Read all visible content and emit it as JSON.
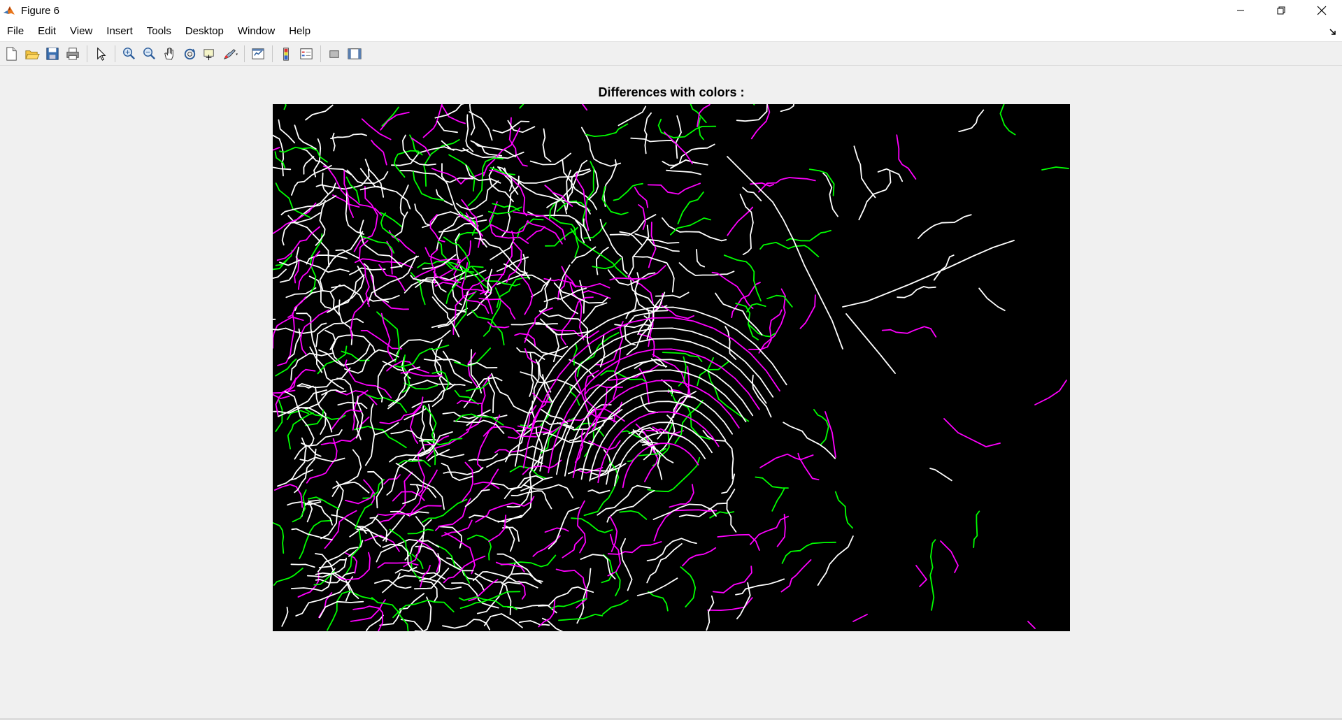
{
  "window": {
    "title": "Figure 6"
  },
  "menu": [
    "File",
    "Edit",
    "View",
    "Insert",
    "Tools",
    "Desktop",
    "Window",
    "Help"
  ],
  "toolbar": [
    {
      "name": "new-figure-icon"
    },
    {
      "name": "open-file-icon"
    },
    {
      "name": "save-icon"
    },
    {
      "name": "print-icon"
    },
    {
      "sep": true
    },
    {
      "name": "edit-plot-arrow-icon"
    },
    {
      "sep": true
    },
    {
      "name": "zoom-in-icon"
    },
    {
      "name": "zoom-out-icon"
    },
    {
      "name": "pan-hand-icon"
    },
    {
      "name": "rotate-3d-icon"
    },
    {
      "name": "data-cursor-icon"
    },
    {
      "name": "brush-icon"
    },
    {
      "sep": true
    },
    {
      "name": "link-plot-icon"
    },
    {
      "sep": true
    },
    {
      "name": "insert-colorbar-icon"
    },
    {
      "name": "insert-legend-icon"
    },
    {
      "sep": true
    },
    {
      "name": "hide-plot-tools-icon"
    },
    {
      "name": "show-plot-tools-icon"
    }
  ],
  "figure": {
    "title": "Differences with colors :",
    "background": "#000000",
    "edge_colors": {
      "both": "#ffffff",
      "first_only": "#ff00ff",
      "second_only": "#00ff00"
    }
  },
  "colors": {
    "titlebar_bg": "#ffffff",
    "window_bg": "#f0f0f0",
    "matlab_icon_orange": "#e8751a"
  }
}
